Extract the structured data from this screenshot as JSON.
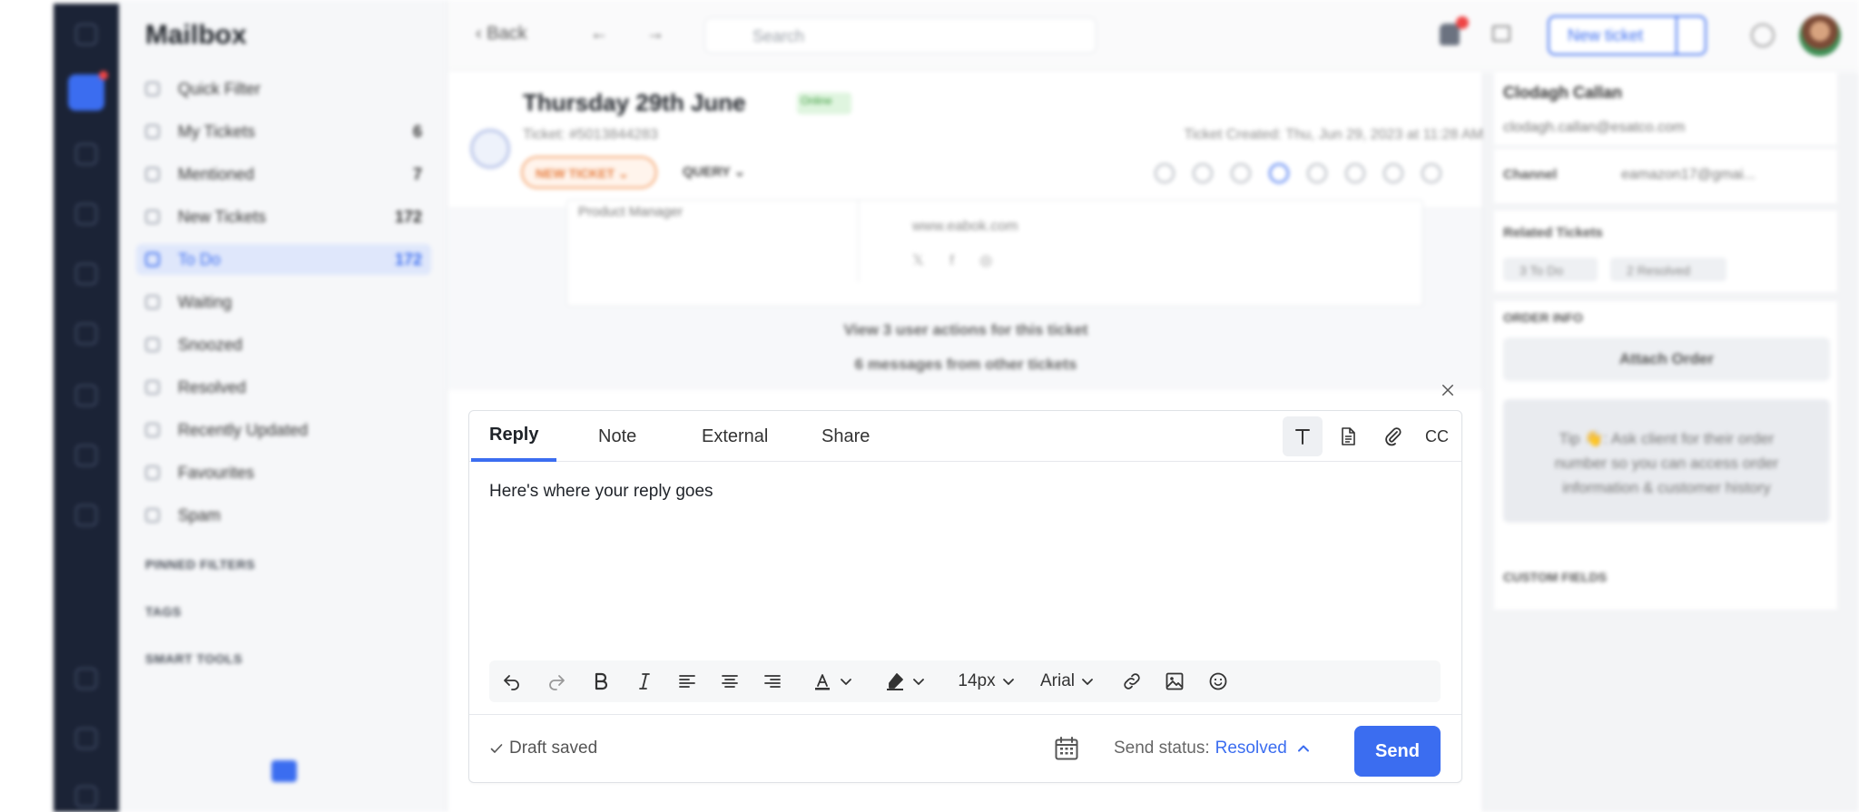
{
  "sidebar": {
    "title": "Mailbox",
    "items": [
      {
        "label": "Quick Filter",
        "count": ""
      },
      {
        "label": "My Tickets",
        "count": "6"
      },
      {
        "label": "Mentioned",
        "count": "7"
      },
      {
        "label": "New Tickets",
        "count": "172"
      },
      {
        "label": "To Do",
        "count": "172"
      },
      {
        "label": "Waiting",
        "count": ""
      },
      {
        "label": "Snoozed",
        "count": ""
      },
      {
        "label": "Resolved",
        "count": ""
      },
      {
        "label": "Recently Updated",
        "count": ""
      },
      {
        "label": "Favourites",
        "count": ""
      },
      {
        "label": "Spam",
        "count": ""
      }
    ],
    "sections": [
      "PINNED FILTERS",
      "TAGS",
      "SMART TOOLS"
    ]
  },
  "topbar": {
    "back_label": "Back",
    "search_placeholder": "Search",
    "new_ticket_label": "New ticket"
  },
  "ticket": {
    "title": "Thursday 29th June",
    "tag": "Online",
    "id": "Ticket: #5013844283",
    "created": "Ticket Created: Thu, Jun 29, 2023 at 11:28 AM",
    "status_pill": "NEW TICKET",
    "category": "QUERY"
  },
  "thread": {
    "signature_role": "Product Manager",
    "signature_website": "www.eabok.com",
    "user_actions": "View 3 user actions for this ticket",
    "other_messages": "6 messages from other tickets"
  },
  "customer": {
    "name": "Clodagh Callan",
    "email": "clodagh.callan@esatco.com",
    "channel_label": "Channel",
    "channel_value": "eamazon17@gmai...",
    "related_title": "Related Tickets",
    "related_todo": "3 To Do",
    "related_resolved": "2 Resolved",
    "order_info_title": "ORDER INFO",
    "attach_order": "Attach Order",
    "tip": "Tip 👋: Ask client for their order number so you can access order information & customer history",
    "custom_fields": "CUSTOM FIELDS"
  },
  "editor": {
    "tabs": [
      "Reply",
      "Note",
      "External",
      "Share"
    ],
    "active_tab": "Reply",
    "cc_label": "CC",
    "body": "Here's where your reply goes",
    "font_size": "14px",
    "font_family": "Arial",
    "draft_status": "Draft saved",
    "send_status_label": "Send status:",
    "send_status_value": "Resolved",
    "send_label": "Send"
  },
  "colors": {
    "accent": "#3b6df0",
    "rail": "#1b2336"
  }
}
